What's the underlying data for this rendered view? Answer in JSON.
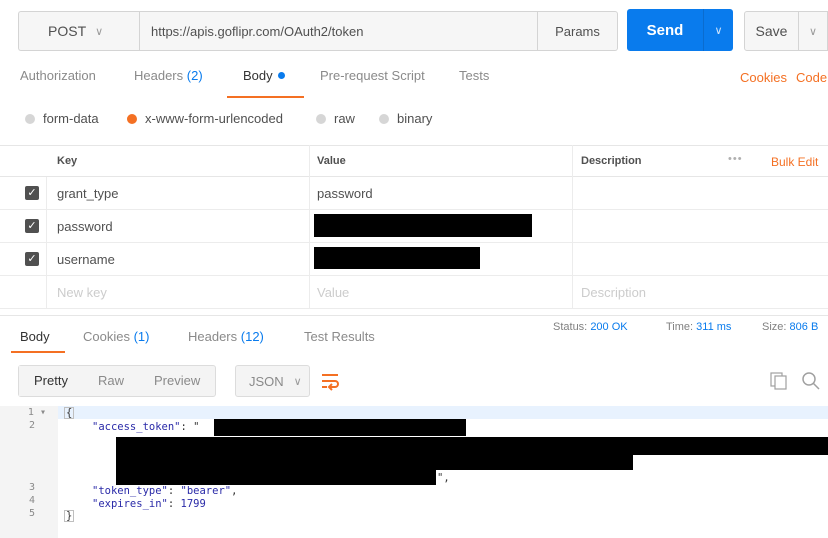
{
  "request": {
    "method": "POST",
    "url": "https://apis.goflipr.com/OAuth2/token",
    "params_label": "Params",
    "send_label": "Send",
    "save_label": "Save"
  },
  "request_tabs": {
    "authorization": "Authorization",
    "headers": "Headers",
    "headers_count": "(2)",
    "body": "Body",
    "prerequest": "Pre-request Script",
    "tests": "Tests",
    "cookies": "Cookies",
    "code": "Code"
  },
  "body_types": {
    "form_data": "form-data",
    "urlencoded": "x-www-form-urlencoded",
    "raw": "raw",
    "binary": "binary",
    "selected": "x-www-form-urlencoded"
  },
  "table": {
    "headers": {
      "key": "Key",
      "value": "Value",
      "description": "Description",
      "more": "•••",
      "bulk_edit": "Bulk Edit"
    },
    "rows": [
      {
        "key": "grant_type",
        "value": "password",
        "checked": true
      },
      {
        "key": "password",
        "value": "",
        "checked": true
      },
      {
        "key": "username",
        "value": "",
        "checked": true
      }
    ],
    "new_row": {
      "key_placeholder": "New key",
      "value_placeholder": "Value",
      "description_placeholder": "Description"
    }
  },
  "response_tabs": {
    "body": "Body",
    "cookies": "Cookies",
    "cookies_count": "(1)",
    "headers": "Headers",
    "headers_count": "(12)",
    "test_results": "Test Results"
  },
  "response_status": {
    "status_label": "Status:",
    "status_value": "200 OK",
    "time_label": "Time:",
    "time_value": "311 ms",
    "size_label": "Size:",
    "size_value": "806 B"
  },
  "response_toolbar": {
    "pretty": "Pretty",
    "raw": "Raw",
    "preview": "Preview",
    "format": "JSON"
  },
  "code": {
    "line_numbers": [
      "1",
      "2",
      "3",
      "4",
      "5"
    ],
    "open_brace": "{",
    "access_token_key": "\"access_token\"",
    "access_token_open": ": \"",
    "access_token_tail": "\",",
    "token_type_key": "\"token_type\"",
    "token_type_value": "\"bearer\"",
    "expires_in_key": "\"expires_in\"",
    "expires_in_value": "1799",
    "close_brace": "}"
  },
  "colors": {
    "accent": "#f47023",
    "primary": "#097bed",
    "redacted": "#000000"
  }
}
